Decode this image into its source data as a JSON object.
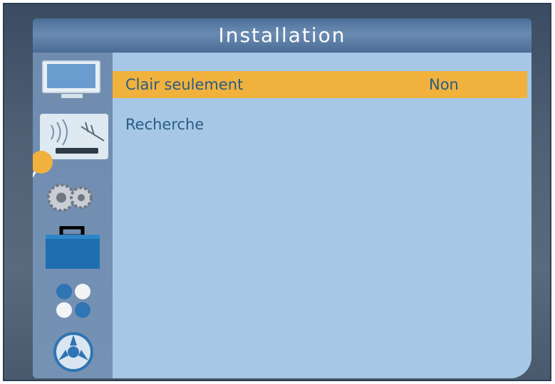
{
  "screen": {
    "title": "Installation"
  },
  "menu": {
    "items": [
      {
        "label": "Clair seulement",
        "value": "Non",
        "selected": true
      },
      {
        "label": "Recherche",
        "value": ""
      }
    ]
  },
  "sidebar": {
    "icons": [
      "tv-icon",
      "antenna-signal-icon",
      "gears-icon",
      "toolbox-icon",
      "dots-icon",
      "reel-icon"
    ],
    "selected_index": 1
  },
  "colors": {
    "highlight": "#f0b23d",
    "content_bg": "#a6c8e6",
    "text": "#2b5b86",
    "title_text": "#ffffff"
  }
}
